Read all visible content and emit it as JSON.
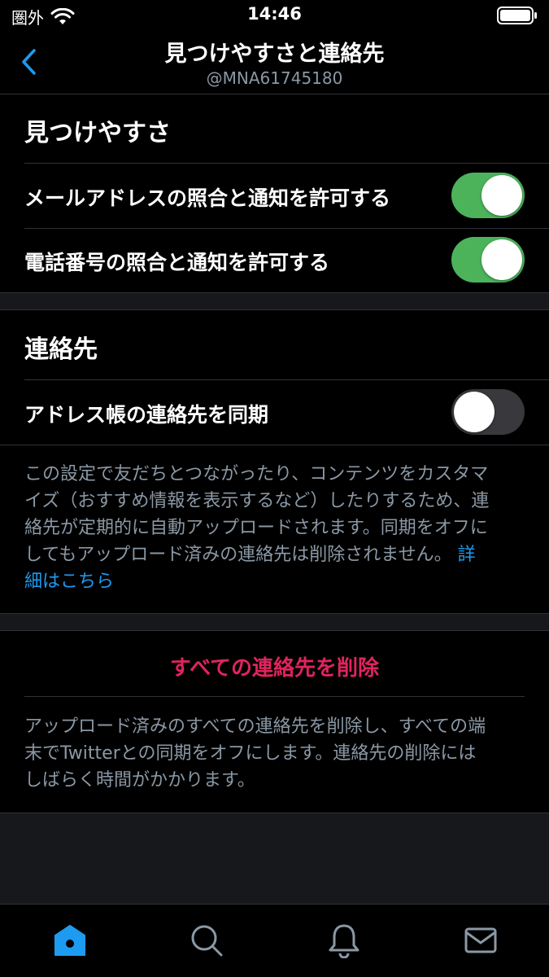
{
  "status_bar": {
    "carrier": "圏外",
    "time": "14:46"
  },
  "nav": {
    "title": "見つけやすさと連絡先",
    "subtitle": "@MNA61745180"
  },
  "discoverability": {
    "title": "見つけやすさ",
    "email_label": "メールアドレスの照合と通知を許可する",
    "email_enabled": true,
    "phone_label": "電話番号の照合と通知を許可する",
    "phone_enabled": true
  },
  "contacts": {
    "title": "連絡先",
    "sync_label": "アドレス帳の連絡先を同期",
    "sync_enabled": false,
    "description_lines": [
      "この設定で友だちとつながったり、コンテンツをカスタマ",
      "イズ（おすすめ情報を表示するなど）したりするため、連",
      "絡先が定期的に自動アップロードされます。同期をオフに",
      "してもアップロード済みの連絡先は削除されません。"
    ],
    "learn_more_part1": "詳",
    "learn_more_part2": "細はこちら"
  },
  "delete": {
    "button_label": "すべての連絡先を削除",
    "description_lines": [
      "アップロード済みのすべての連絡先を削除し、すべての端",
      "末でTwitterとの同期をオフにします。連絡先の削除には",
      "しばらく時間がかかります。"
    ]
  },
  "colors": {
    "accent": "#1d9bf0",
    "toggle_on": "#4cb35b",
    "danger": "#e0245e"
  },
  "icons": {
    "back": "chevron-left-icon",
    "home": "home-icon",
    "search": "search-icon",
    "notifications": "bell-icon",
    "messages": "mail-icon"
  }
}
